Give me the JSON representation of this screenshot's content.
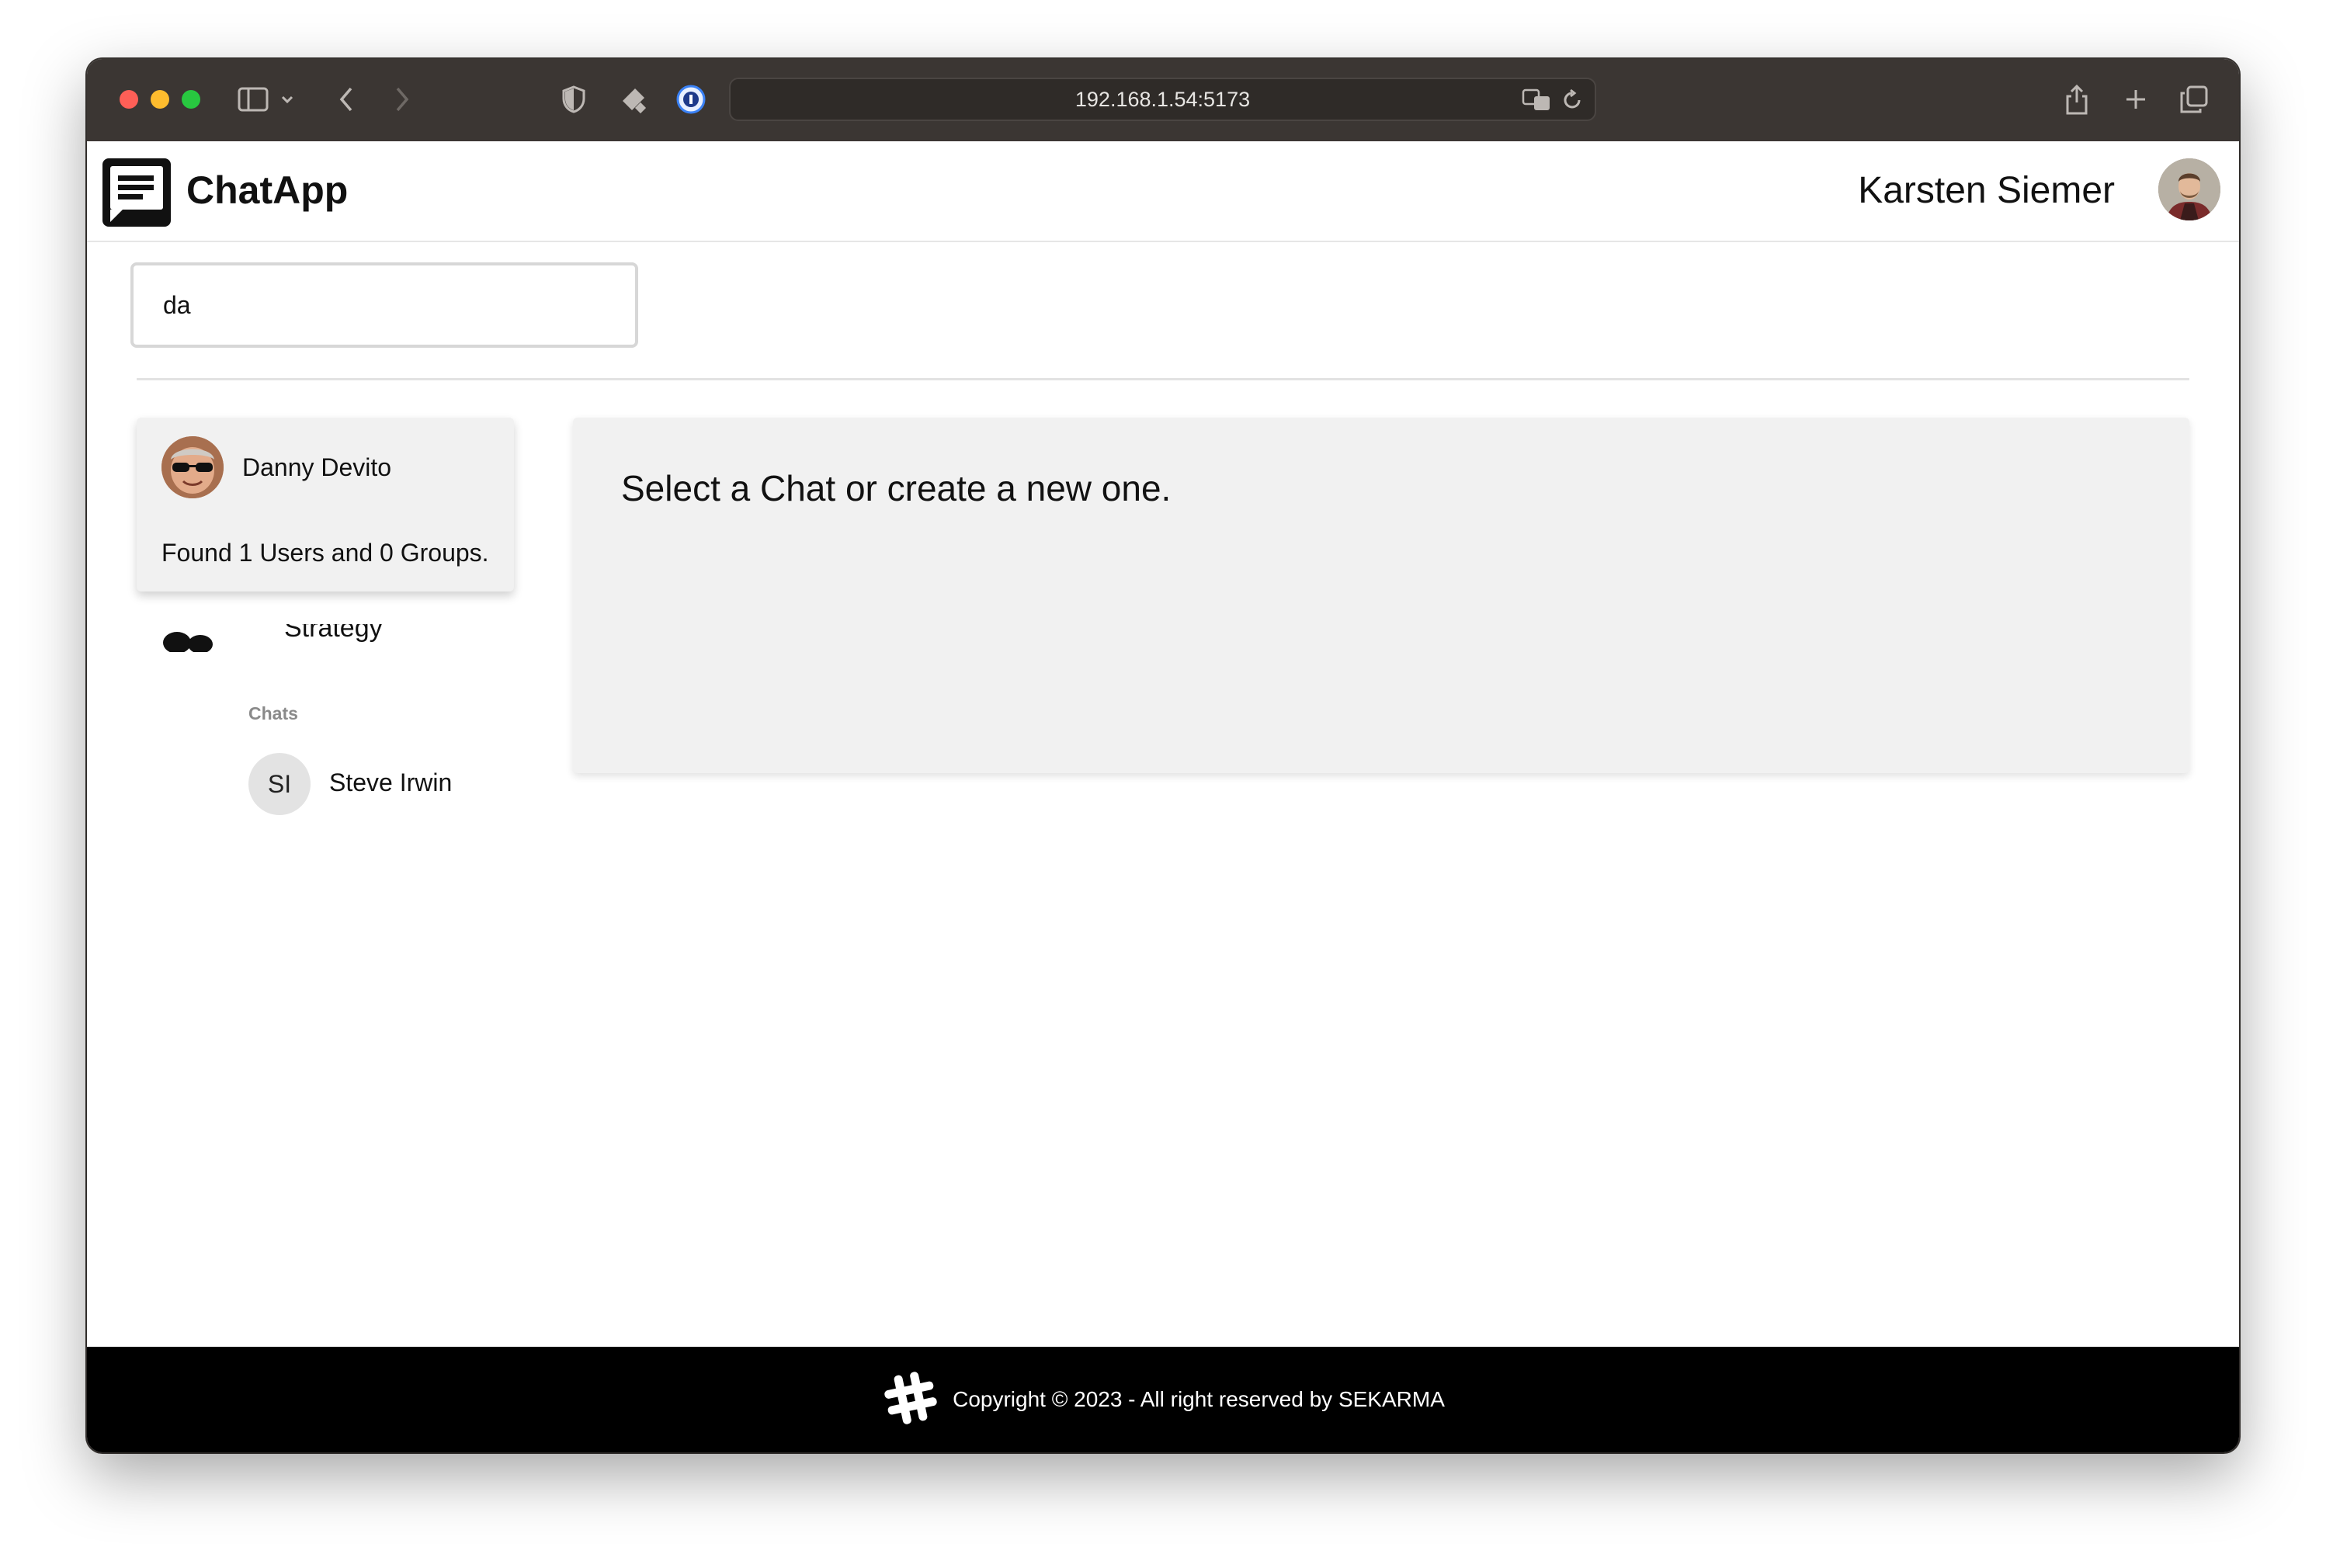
{
  "browser": {
    "url": "192.168.1.54:5173"
  },
  "header": {
    "app_title": "ChatApp",
    "user_name": "Karsten Siemer"
  },
  "search": {
    "value": "da"
  },
  "search_results": {
    "users": [
      {
        "name": "Danny Devito"
      }
    ],
    "summary": "Found 1 Users and 0 Groups."
  },
  "sidebar": {
    "partial_group_label": "Strategy",
    "chats_section_label": "Chats",
    "chats": [
      {
        "initials": "SI",
        "name": "Steve Irwin"
      }
    ]
  },
  "main": {
    "placeholder_message": "Select a Chat or create a new one."
  },
  "footer": {
    "copyright": "Copyright © 2023 - All right reserved by SEKARMA"
  }
}
